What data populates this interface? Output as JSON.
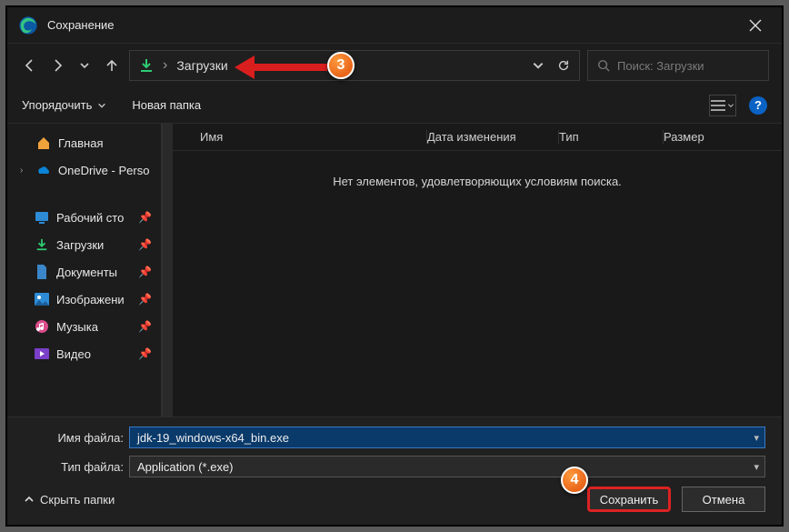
{
  "window": {
    "title": "Сохранение"
  },
  "address": {
    "location": "Загрузки"
  },
  "search": {
    "placeholder": "Поиск: Загрузки"
  },
  "toolbar": {
    "organize": "Упорядочить",
    "new_folder": "Новая папка"
  },
  "columns": {
    "name": "Имя",
    "date": "Дата изменения",
    "type": "Тип",
    "size": "Размер"
  },
  "list": {
    "empty_text": "Нет элементов, удовлетворяющих условиям поиска."
  },
  "sidebar": {
    "home": "Главная",
    "onedrive": "OneDrive - Perso",
    "desktop": "Рабочий сто",
    "downloads": "Загрузки",
    "documents": "Документы",
    "pictures": "Изображени",
    "music": "Музыка",
    "videos": "Видео"
  },
  "fields": {
    "name_label": "Имя файла:",
    "name_value": "jdk-19_windows-x64_bin.exe",
    "type_label": "Тип файла:",
    "type_value": "Application (*.exe)"
  },
  "footer": {
    "hide_folders": "Скрыть папки",
    "save": "Сохранить",
    "cancel": "Отмена"
  },
  "annotations": {
    "step3": "3",
    "step4": "4"
  }
}
